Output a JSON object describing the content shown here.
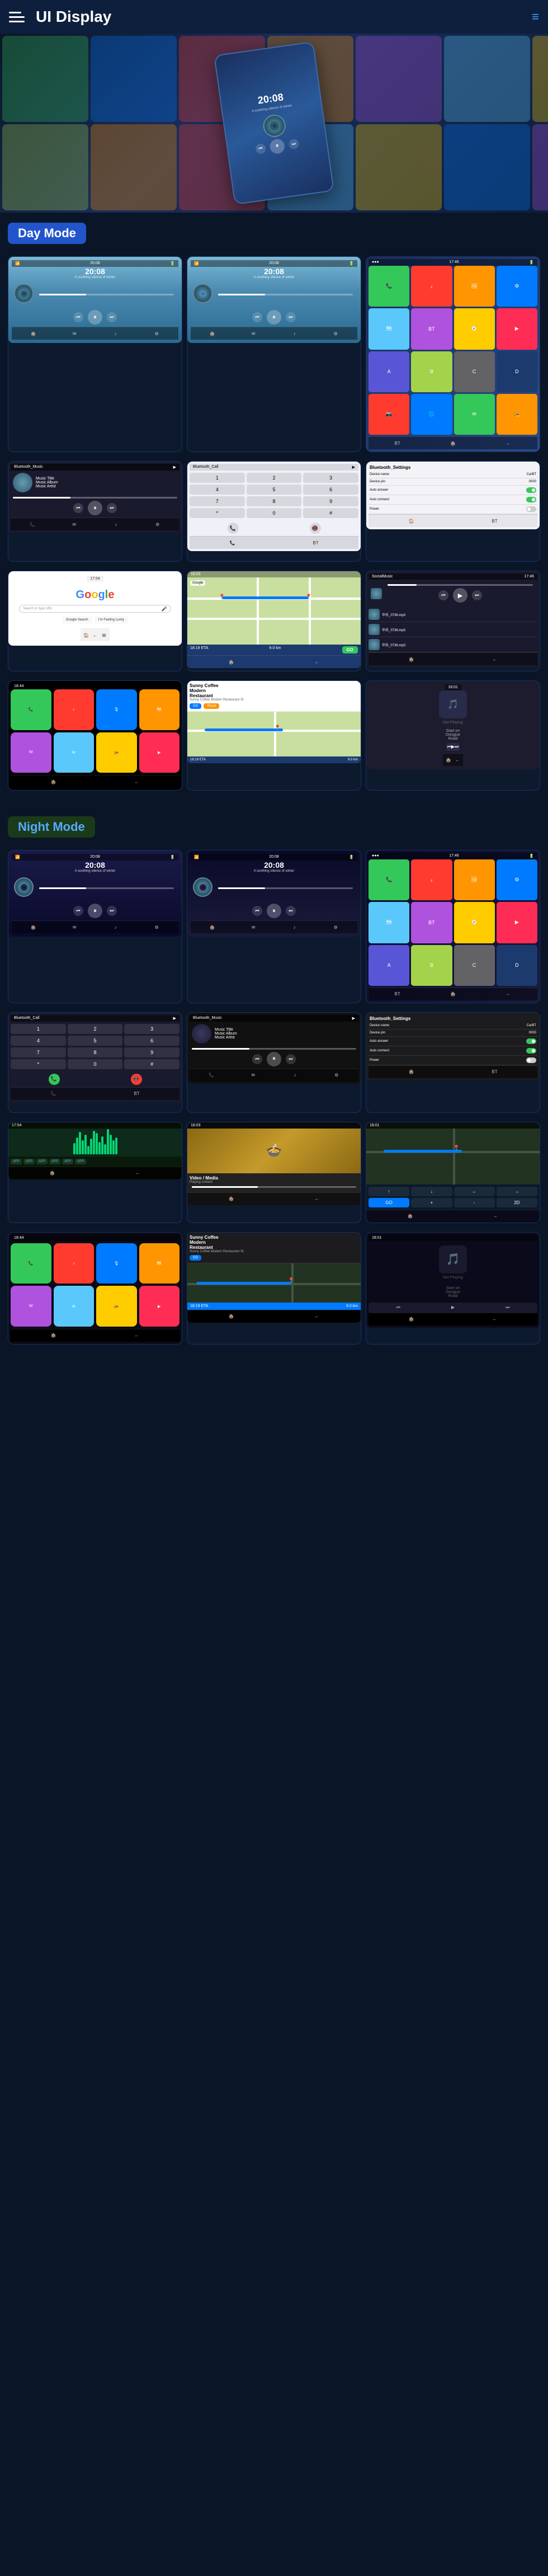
{
  "header": {
    "title": "UI Display",
    "menu_icon": "≡",
    "hamburger_lines": 3
  },
  "sections": {
    "day_mode": "Day Mode",
    "night_mode": "Night Mode"
  },
  "hero": {
    "device_time": "20:08",
    "device_subtitle": "A soothing silence of winter"
  },
  "music_info": {
    "title": "Music Album\nMusic Artist",
    "subtitle": "Music Title\nMusic Album\nMusic Artist"
  },
  "app_icons": {
    "colors": [
      "#34c759",
      "#007aff",
      "#ff3b30",
      "#ff9500",
      "#af52de",
      "#5ac8fa",
      "#ffcc00",
      "#636366",
      "#ff2d55",
      "#5856d6",
      "#a2d34a",
      "#1c3a6e"
    ]
  },
  "settings": {
    "device_name_label": "Device name",
    "device_name_value": "CarBT",
    "device_pin_label": "Device pin",
    "device_pin_value": "0000",
    "auto_answer_label": "Auto answer",
    "auto_connect_label": "Auto connect",
    "power_label": "Power"
  },
  "map_info": {
    "eta": "18:19 ETA",
    "distance": "9.0 km",
    "go_label": "GO",
    "not_playing": "Not Playing",
    "route_label": "Start on\nDongjue\nRoad"
  },
  "nav": {
    "place_name": "Sunny Coffee\nModern\nRestaurant",
    "address": "Sunny Coffee Modern\nRestaurant St",
    "go_label": "GO"
  },
  "times": {
    "status_time_1": "20:08",
    "status_time_2": "20:08"
  }
}
